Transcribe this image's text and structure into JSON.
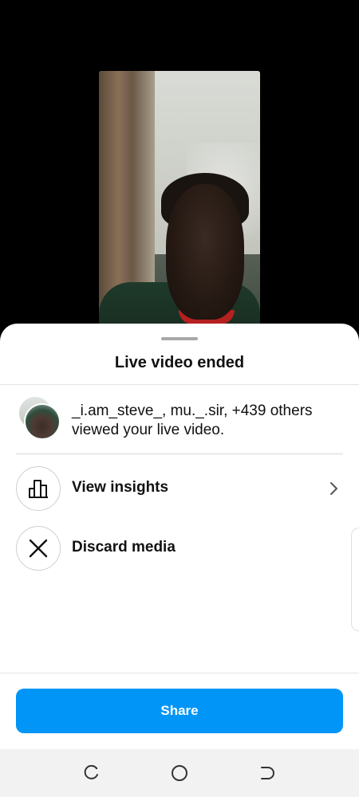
{
  "sheet": {
    "title": "Live video ended",
    "viewers_text": "_i.am_steve_, mu._.sir, +439 others viewed your live video."
  },
  "actions": [
    {
      "label": "View insights",
      "icon": "bar-chart-icon"
    },
    {
      "label": "Discard media",
      "icon": "close-icon"
    }
  ],
  "share": {
    "label": "Share"
  },
  "colors": {
    "accent": "#0095f6",
    "background": "#000000",
    "sheet": "#ffffff",
    "nav_bar": "#f2f2f2"
  },
  "nav": [
    "recent-apps-icon",
    "home-icon",
    "back-icon"
  ]
}
